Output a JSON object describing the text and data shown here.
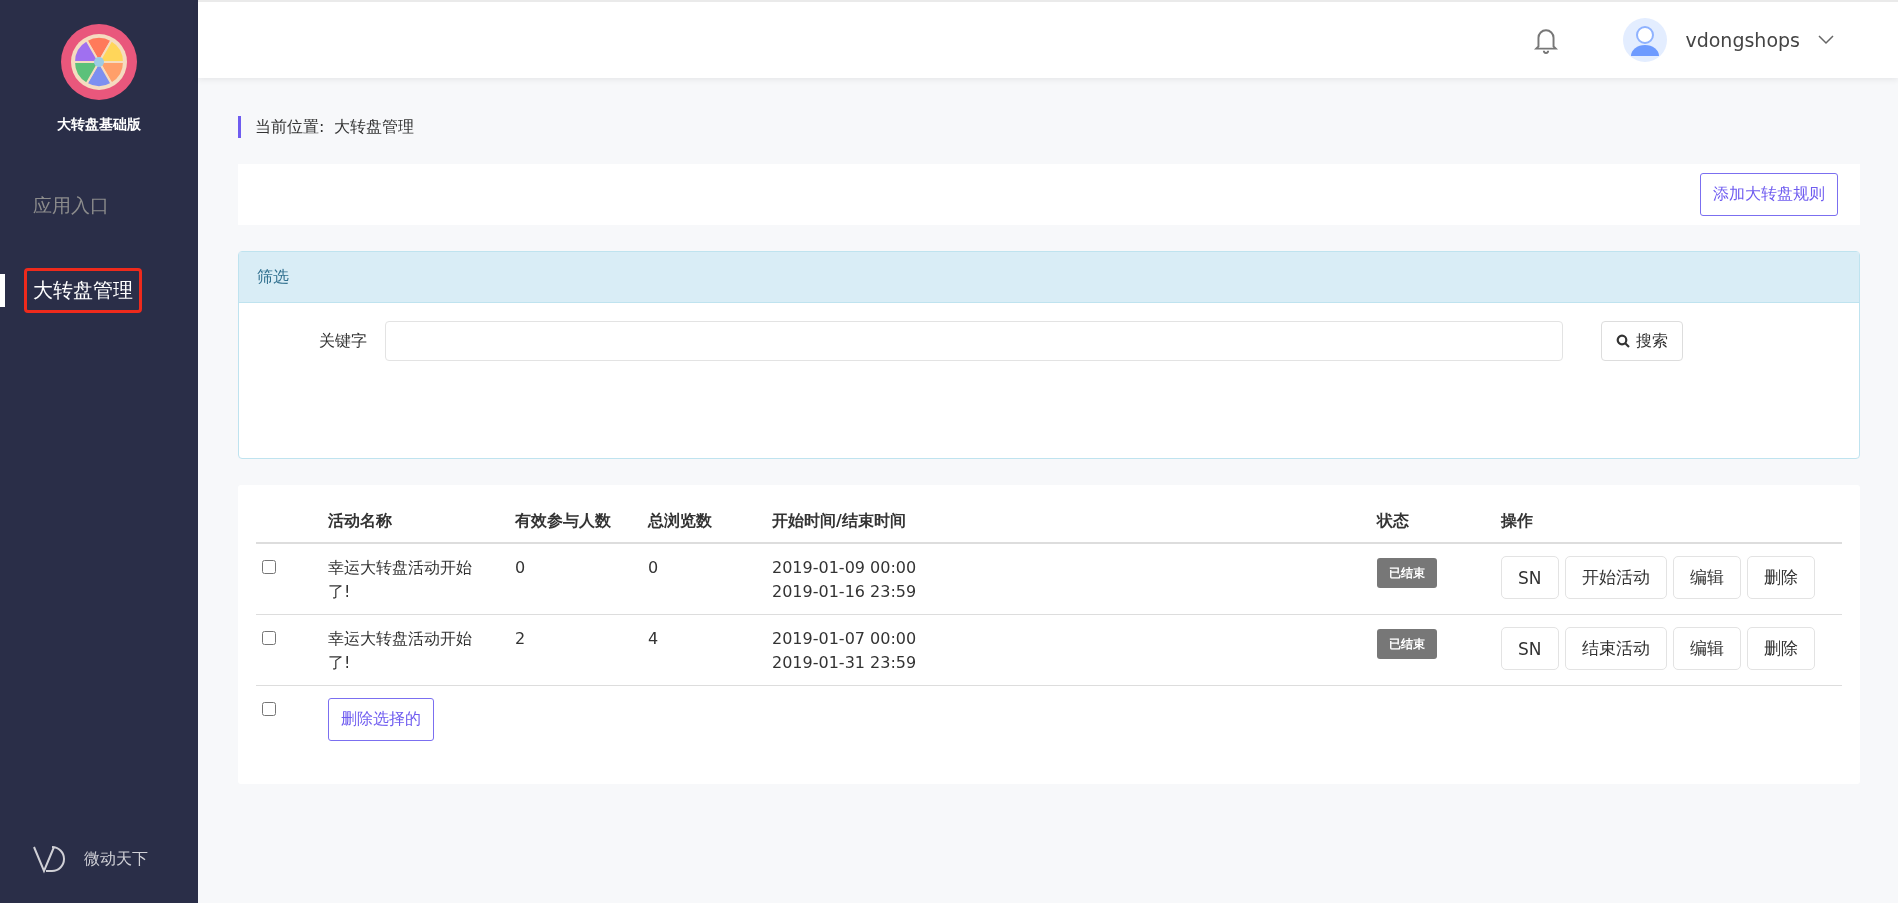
{
  "sidebar": {
    "app_name": "大转盘基础版",
    "items": [
      {
        "label": "应用入口",
        "selected": false
      },
      {
        "label": "大转盘管理",
        "selected": true
      }
    ],
    "footer": "微动天下"
  },
  "header": {
    "username": "vdongshops"
  },
  "breadcrumb": {
    "label": "当前位置:",
    "current": "大转盘管理"
  },
  "toolbar": {
    "add_button": "添加大转盘规则"
  },
  "filter": {
    "title": "筛选",
    "keyword_label": "关键字",
    "search_button": "搜索"
  },
  "table": {
    "columns": [
      "活动名称",
      "有效参与人数",
      "总浏览数",
      "开始时间/结束时间",
      "状态",
      "操作"
    ],
    "rows": [
      {
        "checked": false,
        "name": "幸运大转盘活动开始了!",
        "participants": "0",
        "views": "0",
        "start": "2019-01-09 00:00",
        "end": "2019-01-16 23:59",
        "status": "已结束",
        "actions": [
          "SN",
          "开始活动",
          "编辑",
          "删除"
        ]
      },
      {
        "checked": false,
        "name": "幸运大转盘活动开始了!",
        "participants": "2",
        "views": "4",
        "start": "2019-01-07 00:00",
        "end": "2019-01-31 23:59",
        "status": "已结束",
        "actions": [
          "SN",
          "结束活动",
          "编辑",
          "删除"
        ]
      }
    ],
    "select_all_checked": false,
    "delete_selected": "删除选择的"
  }
}
